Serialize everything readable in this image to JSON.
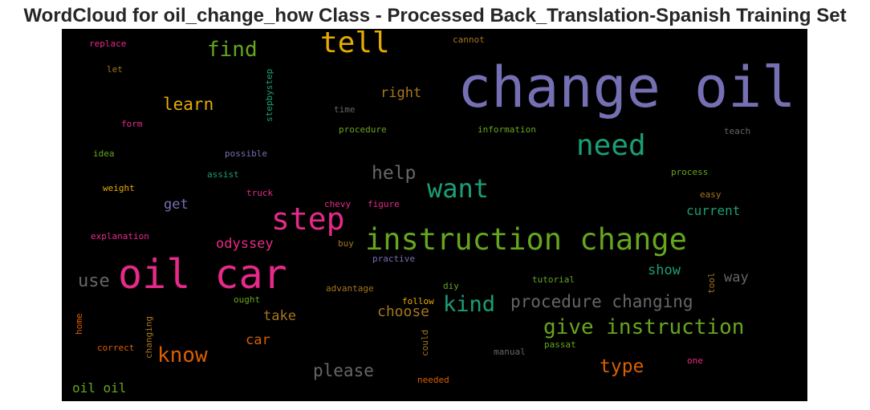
{
  "title": "WordCloud for oil_change_how Class - Processed Back_Translation-Spanish Training Set",
  "colors": {
    "background": "#000000",
    "title": "#262626",
    "palette": [
      "#7570b3",
      "#e7298a",
      "#66a61e",
      "#1b9e77",
      "#e6ab02",
      "#d95f02",
      "#a6761d",
      "#666666"
    ]
  },
  "words": {
    "change_oil": "change oil",
    "oil_car": "oil car",
    "instruction_change": "instruction change",
    "step": "step",
    "tell": "tell",
    "need": "need",
    "want": "want",
    "give_instruction": "give instruction",
    "procedure_changing": "procedure changing",
    "kind": "kind",
    "know": "know",
    "find": "find",
    "learn": "learn",
    "help": "help",
    "type": "type",
    "use": "use",
    "please": "please",
    "choose": "choose",
    "odyssey": "odyssey",
    "take": "take",
    "car": "car",
    "show": "show",
    "current": "current",
    "way": "way",
    "get": "get",
    "right": "right",
    "oil_oil": "oil oil",
    "replace": "replace",
    "let": "let",
    "form": "form",
    "idea": "idea",
    "weight": "weight",
    "explanation": "explanation",
    "assist": "assist",
    "truck": "truck",
    "possible": "possible",
    "stepbystep": "stepbystep",
    "time": "time",
    "procedure": "procedure",
    "cannot": "cannot",
    "information": "information",
    "teach": "teach",
    "process": "process",
    "easy": "easy",
    "chevy": "chevy",
    "figure": "figure",
    "buy": "buy",
    "practive": "practive",
    "advantage": "advantage",
    "diy": "diy",
    "tutorial": "tutorial",
    "tool": "tool",
    "ought": "ought",
    "follow": "follow",
    "home": "home",
    "changing": "changing",
    "correct": "correct",
    "could": "could",
    "manual": "manual",
    "passat": "passat",
    "one": "one",
    "needed": "needed"
  }
}
